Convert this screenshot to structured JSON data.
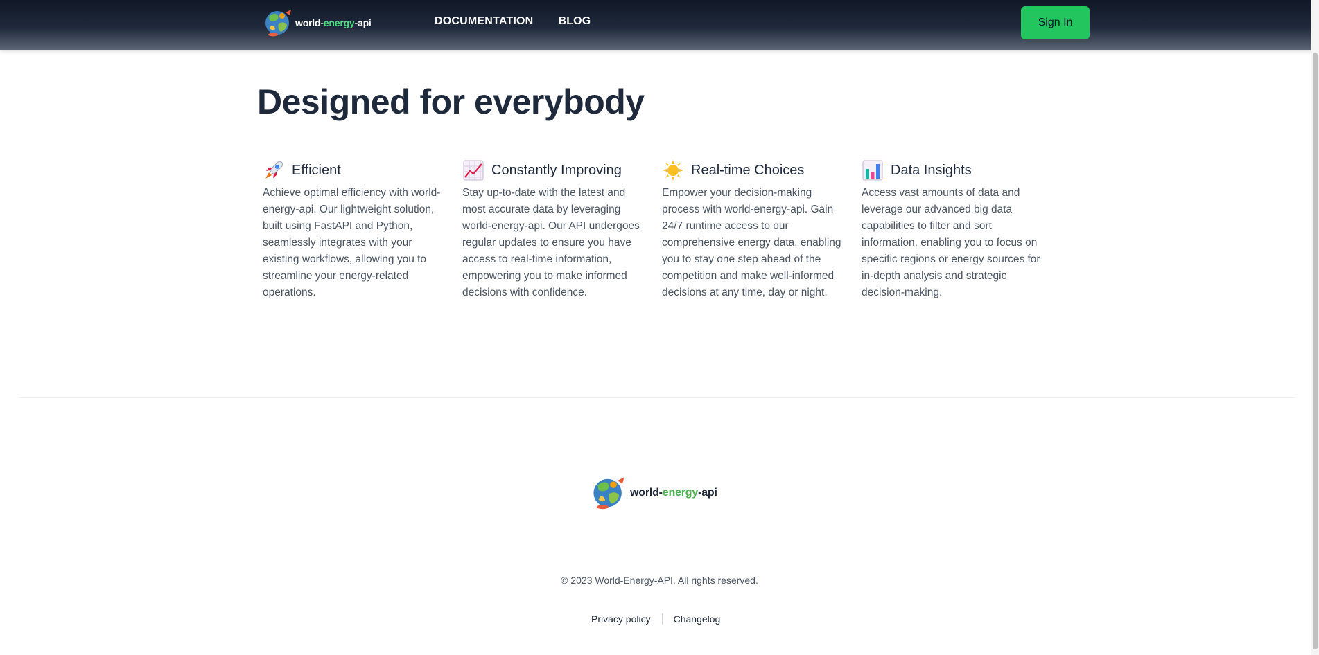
{
  "header": {
    "logo": {
      "prefix": "world-",
      "highlight": "energy",
      "suffix": "-api"
    },
    "nav": {
      "documentation": "DOCUMENTATION",
      "blog": "BLOG"
    },
    "signin_label": "Sign In"
  },
  "main": {
    "headline": "Designed for everybody",
    "features": [
      {
        "icon": "rocket-icon",
        "title": "Efficient",
        "description": "Achieve optimal efficiency with world-energy-api. Our lightweight solution, built using FastAPI and Python, seamlessly integrates with your existing workflows, allowing you to streamline your energy-related operations."
      },
      {
        "icon": "chart-increasing-icon",
        "title": "Constantly Improving",
        "description": "Stay up-to-date with the latest and most accurate data by leveraging world-energy-api. Our API undergoes regular updates to ensure you have access to real-time information, empowering you to make informed decisions with confidence."
      },
      {
        "icon": "sun-icon",
        "title": "Real-time Choices",
        "description": "Empower your decision-making process with world-energy-api. Gain 24/7 runtime access to our comprehensive energy data, enabling you to stay one step ahead of the competition and make well-informed decisions at any time, day or night."
      },
      {
        "icon": "bar-chart-icon",
        "title": "Data Insights",
        "description": "Access vast amounts of data and leverage our advanced big data capabilities to filter and sort information, enabling you to focus on specific regions or energy sources for in-depth analysis and strategic decision-making."
      }
    ]
  },
  "footer": {
    "logo": {
      "prefix": "world-",
      "highlight": "energy",
      "suffix": "-api"
    },
    "copyright": "© 2023 World-Energy-API. All rights reserved.",
    "links": {
      "privacy": "Privacy policy",
      "changelog": "Changelog"
    }
  },
  "colors": {
    "accent": "#22c55e",
    "header_bg": "#111827",
    "headline": "#1e293b"
  }
}
